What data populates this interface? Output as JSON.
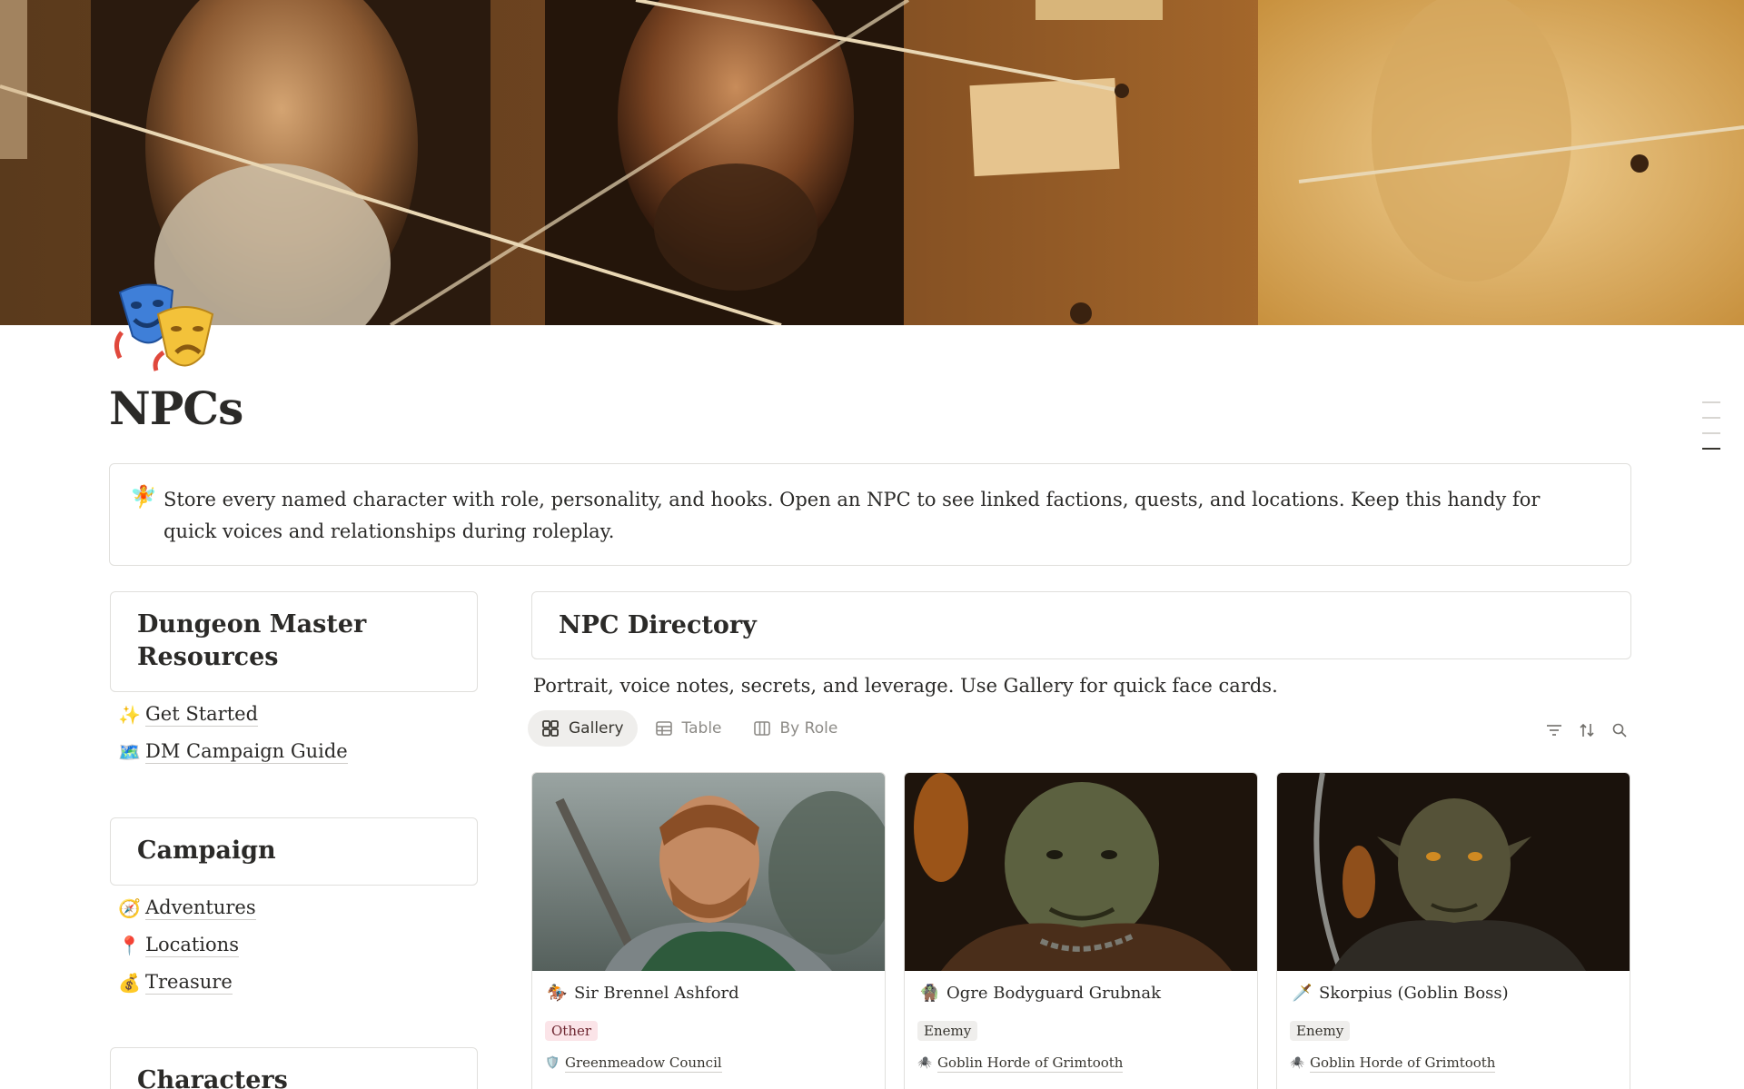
{
  "page": {
    "icon": "theater-masks-icon",
    "title": "NPCs"
  },
  "callout": {
    "icon": "fairy-icon",
    "icon_glyph": "🧚",
    "text": "Store every named character with role, personality, and hooks. Open an NPC to see linked factions, quests, and locations. Keep this handy for quick voices and relationships during roleplay."
  },
  "sidebar": {
    "sections": [
      {
        "title": "Dungeon Master Resources",
        "links": [
          {
            "icon_glyph": "✨",
            "label": "Get Started"
          },
          {
            "icon_glyph": "🗺️",
            "label": "DM Campaign Guide"
          }
        ]
      },
      {
        "title": "Campaign",
        "links": [
          {
            "icon_glyph": "🧭",
            "label": "Adventures"
          },
          {
            "icon_glyph": "📍",
            "label": "Locations"
          },
          {
            "icon_glyph": "💰",
            "label": "Treasure"
          }
        ]
      },
      {
        "title": "Characters",
        "links": []
      }
    ]
  },
  "directory": {
    "title": "NPC Directory",
    "description": "Portrait, voice notes, secrets, and leverage. Use Gallery for quick face cards.",
    "tabs": [
      {
        "label": "Gallery",
        "icon": "gallery-icon",
        "active": true
      },
      {
        "label": "Table",
        "icon": "table-icon",
        "active": false
      },
      {
        "label": "By Role",
        "icon": "board-icon",
        "active": false
      }
    ],
    "tools": [
      "filter-icon",
      "sort-icon",
      "search-icon"
    ],
    "cards": [
      {
        "emoji": "🏇",
        "name": "Sir Brennel Ashford",
        "tag": "Other",
        "tag_color": "#fbe4e8",
        "tag_text_color": "#6e2630",
        "faction_emoji": "🛡️",
        "faction": "Greenmeadow Council"
      },
      {
        "emoji": "🧌",
        "name": "Ogre Bodyguard Grubnak",
        "tag": "Enemy",
        "tag_color": "#efeeec",
        "tag_text_color": "#37352f",
        "faction_emoji": "🕷️",
        "faction": "Goblin Horde of Grimtooth"
      },
      {
        "emoji": "🗡️",
        "name": "Skorpius (Goblin Boss)",
        "tag": "Enemy",
        "tag_color": "#efeeec",
        "tag_text_color": "#37352f",
        "faction_emoji": "🕷️",
        "faction": "Goblin Horde of Grimtooth"
      }
    ]
  }
}
